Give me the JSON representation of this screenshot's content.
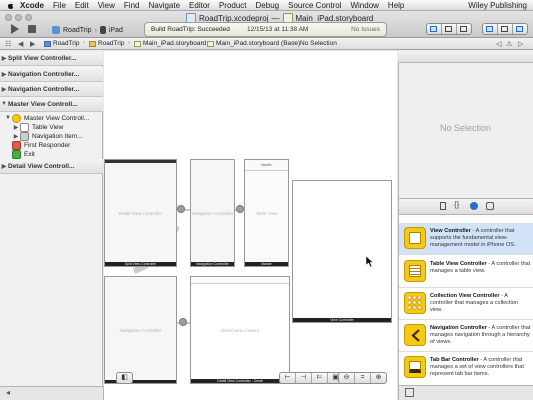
{
  "menubar": {
    "app": "Xcode",
    "items": [
      "File",
      "Edit",
      "View",
      "Find",
      "Navigate",
      "Editor",
      "Product",
      "Debug",
      "Source Control",
      "Window",
      "Help"
    ],
    "right": "Wiley Publishing"
  },
  "titlebar": {
    "project": "RoadTrip.xcodeproj",
    "separator": "—",
    "file": "Main_iPad.storyboard"
  },
  "toolbar": {
    "scheme": "RoadTrip",
    "destination": "iPad",
    "activity_status": "Build RoadTrip: Succeeded",
    "activity_time": "12/15/13 at 11:38 AM",
    "activity_issues": "No Issues"
  },
  "jumpbar": {
    "crumbs": [
      "RoadTrip",
      "RoadTrip",
      "Main_iPad.storyboard",
      "Main_iPad.storyboard (Base)",
      "No Selection"
    ]
  },
  "outline": {
    "sections": [
      {
        "label": "Split View Controller..."
      },
      {
        "label": "Navigation Controller..."
      },
      {
        "label": "Navigation Controller..."
      },
      {
        "label": "Master View Controll..."
      },
      {
        "label": "Detail View Controll..."
      }
    ],
    "master_children": [
      {
        "label": "Master View Controll..."
      },
      {
        "label": "Table View"
      },
      {
        "label": "Navigation Item..."
      },
      {
        "label": "First Responder"
      },
      {
        "label": "Exit"
      }
    ]
  },
  "canvas": {
    "scenes": [
      {
        "label": "Detail View Controller",
        "caption": "Split View Controller"
      },
      {
        "label": "Navigation Controller",
        "caption": "Navigation Controller"
      },
      {
        "label": "Table View",
        "nav_title": "Master",
        "caption": "Master View Controller - Master"
      },
      {
        "label": "",
        "caption": "View Controller"
      },
      {
        "label": "Navigation Controller",
        "caption": ""
      },
      {
        "label": "Detail view content",
        "caption": "Detail View Controller - Detail"
      }
    ]
  },
  "inspector": {
    "empty_text": "No Selection"
  },
  "library": {
    "items": [
      {
        "title": "View Controller",
        "desc": " - A controller that supports the fundamental view-management model in iPhone OS."
      },
      {
        "title": "Table View Controller",
        "desc": " - A controller that manages a table view."
      },
      {
        "title": "Collection View Controller",
        "desc": " - A controller that manages a collection view."
      },
      {
        "title": "Navigation Controller",
        "desc": " - A controller that manages navigation through a hierarchy of views."
      },
      {
        "title": "Tab Bar Controller",
        "desc": " - A controller that manages a set of view controllers that represent tab bar items."
      }
    ]
  },
  "colors": {
    "selection": "#d3e3f7",
    "accent": "#2a6bd0",
    "library_icon": "#f6c915"
  }
}
